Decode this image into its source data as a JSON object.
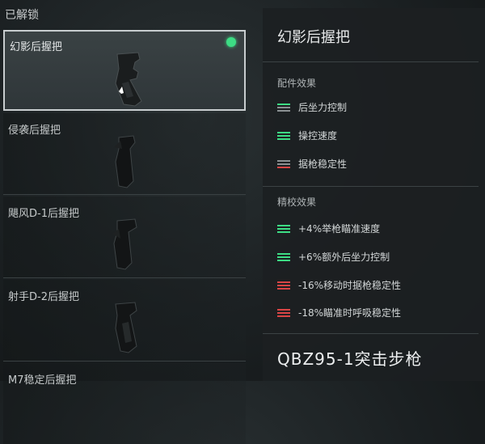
{
  "section_title": "已解锁",
  "items": [
    {
      "name": "幻影后握把",
      "selected": true
    },
    {
      "name": "侵袭后握把"
    },
    {
      "name": "飓风D-1后握把"
    },
    {
      "name": "射手D-2后握把"
    },
    {
      "name": "M7稳定后握把"
    }
  ],
  "detail": {
    "title": "幻影后握把",
    "effects_label": "配件效果",
    "effects": [
      "后坐力控制",
      "操控速度",
      "据枪稳定性"
    ],
    "refine_label": "精校效果",
    "refine": [
      "+4%举枪瞄准速度",
      "+6%额外后坐力控制",
      "-16%移动时据枪稳定性",
      "-18%瞄准时呼吸稳定性"
    ],
    "weapon": "QBZ95-1突击步枪"
  },
  "colors": {
    "positive": "#3ddc84",
    "negative": "#d94545",
    "neutral": "#8a9092"
  }
}
